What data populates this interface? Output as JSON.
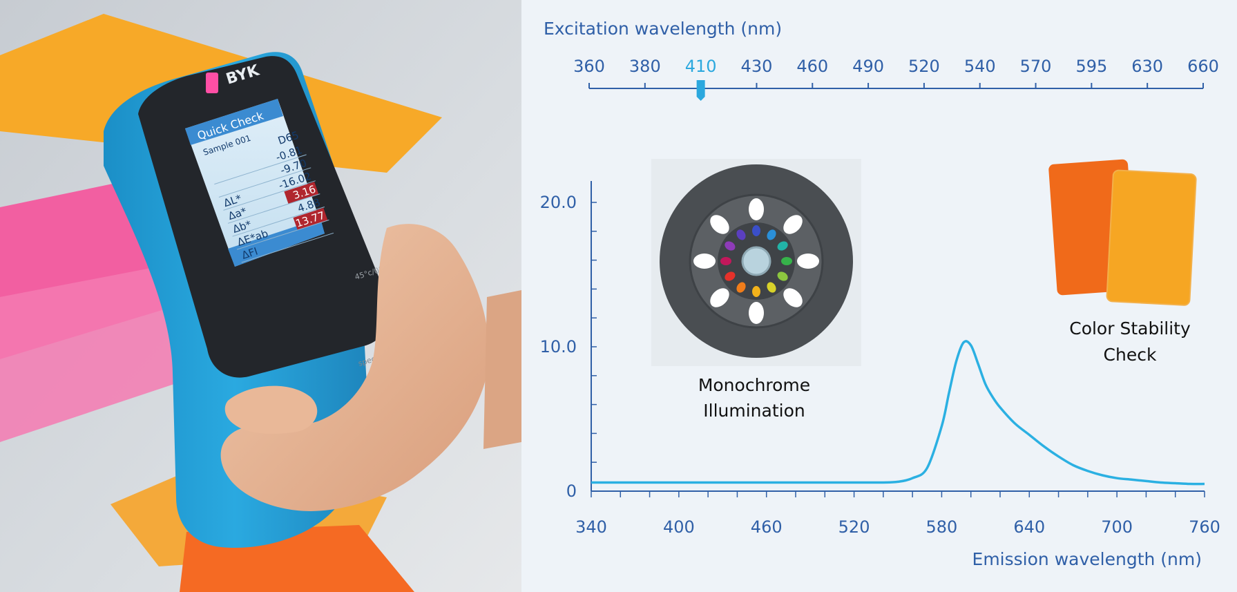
{
  "photo": {
    "brand_logo": "BYK",
    "device_model": "spectro2guide",
    "geometry_label": "45°c/0°",
    "screen": {
      "title": "Quick Check",
      "sample": "Sample 001",
      "illuminant": "D65",
      "rows": [
        {
          "label": "",
          "value": "-0.81",
          "fail": false
        },
        {
          "label": "",
          "value": "-9.70",
          "fail": false
        },
        {
          "label": "ΔL*",
          "value": "-16.02",
          "fail": false
        },
        {
          "label": "Δa*",
          "value": "3.16",
          "fail": true
        },
        {
          "label": "Δb*",
          "value": "4.88",
          "fail": false
        },
        {
          "label": "ΔE*ab",
          "value": "13.77",
          "fail": true
        },
        {
          "label": "ΔFI",
          "value": "",
          "fail": false
        }
      ]
    }
  },
  "chart_data": {
    "type": "line",
    "title": "",
    "excitation_axis": {
      "label": "Excitation wavelength (nm)",
      "ticks": [
        "360",
        "380",
        "410",
        "430",
        "460",
        "490",
        "520",
        "540",
        "570",
        "595",
        "630",
        "660"
      ],
      "selected": "410",
      "selected_index": 2
    },
    "xlabel": "Emission wavelength (nm)",
    "ylabel": "",
    "xlim": [
      340,
      760
    ],
    "ylim": [
      0,
      21
    ],
    "xticks": [
      "340",
      "400",
      "460",
      "520",
      "580",
      "640",
      "700",
      "760"
    ],
    "yticks": [
      "0",
      "10.0",
      "20.0"
    ],
    "series": [
      {
        "name": "",
        "color": "#2bb0e2",
        "x": [
          340,
          400,
          460,
          520,
          540,
          550,
          560,
          570,
          580,
          585,
          590,
          595,
          600,
          605,
          610,
          615,
          620,
          630,
          640,
          650,
          660,
          670,
          680,
          690,
          700,
          710,
          720,
          730,
          740,
          750,
          760
        ],
        "y": [
          0.6,
          0.6,
          0.6,
          0.6,
          0.6,
          0.65,
          0.9,
          1.6,
          4.5,
          6.8,
          9.0,
          10.3,
          10.1,
          8.8,
          7.4,
          6.5,
          5.8,
          4.7,
          3.9,
          3.1,
          2.4,
          1.8,
          1.4,
          1.1,
          0.9,
          0.8,
          0.7,
          0.6,
          0.55,
          0.5,
          0.5
        ]
      }
    ],
    "grid": false,
    "annotations": [
      {
        "id": "monochrome",
        "label_lines": [
          "Monochrome",
          "Illumination"
        ]
      },
      {
        "id": "stability",
        "label_lines": [
          "Color Stability",
          "Check"
        ]
      }
    ]
  },
  "colors": {
    "axis": "#2f5fa7",
    "selected_tick": "#2ba8de",
    "curve": "#2bb0e2",
    "panel_bg": "#eef3f8",
    "device_body": "#2aa6dc",
    "device_face": "#23262b"
  }
}
